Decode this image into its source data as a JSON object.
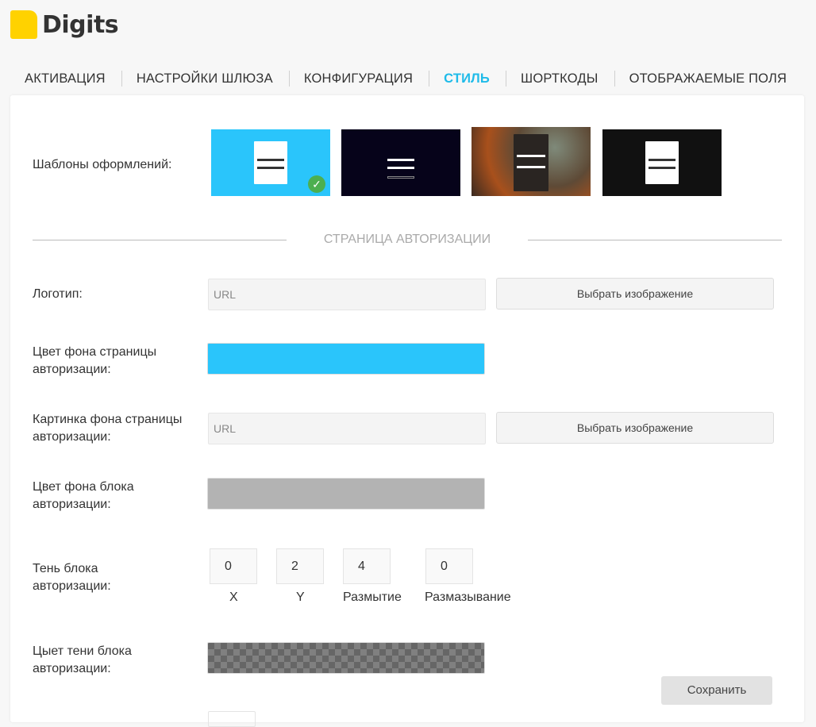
{
  "app": {
    "title": "Digits"
  },
  "tabs": [
    {
      "label": "АКТИВАЦИЯ"
    },
    {
      "label": "НАСТРОЙКИ ШЛЮЗА"
    },
    {
      "label": "КОНФИГУРАЦИЯ"
    },
    {
      "label": "СТИЛЬ",
      "active": true
    },
    {
      "label": "ШОРТКОДЫ"
    },
    {
      "label": "ОТОБРАЖАЕМЫЕ ПОЛЯ"
    }
  ],
  "templates": {
    "label": "Шаблоны оформлений:",
    "selected": 0
  },
  "section": {
    "title": "СТРАНИЦА АВТОРИЗАЦИИ"
  },
  "logo": {
    "label": "Логотип:",
    "placeholder": "URL",
    "button": "Выбрать изображение"
  },
  "page_bg_color": {
    "label": "Цвет фона страницы авторизации:",
    "value": "#2ac5fb"
  },
  "page_bg_image": {
    "label": "Картинка фона страницы авторизации:",
    "placeholder": "URL",
    "button": "Выбрать изображение"
  },
  "block_bg_color": {
    "label": "Цвет фона блока авторизации:",
    "value": "#b3b3b3"
  },
  "shadow": {
    "label": "Тень блока авторизации:",
    "x": "0",
    "y": "2",
    "blur": "4",
    "spread": "0",
    "x_label": "X",
    "y_label": "Y",
    "blur_label": "Размытие",
    "spread_label": "Размазывание"
  },
  "shadow_color": {
    "label": "Цыет тени блока авторизации:"
  },
  "save_label": "Сохранить",
  "colors": {
    "accent": "#1fbbe9",
    "logo": "#ffd200"
  }
}
